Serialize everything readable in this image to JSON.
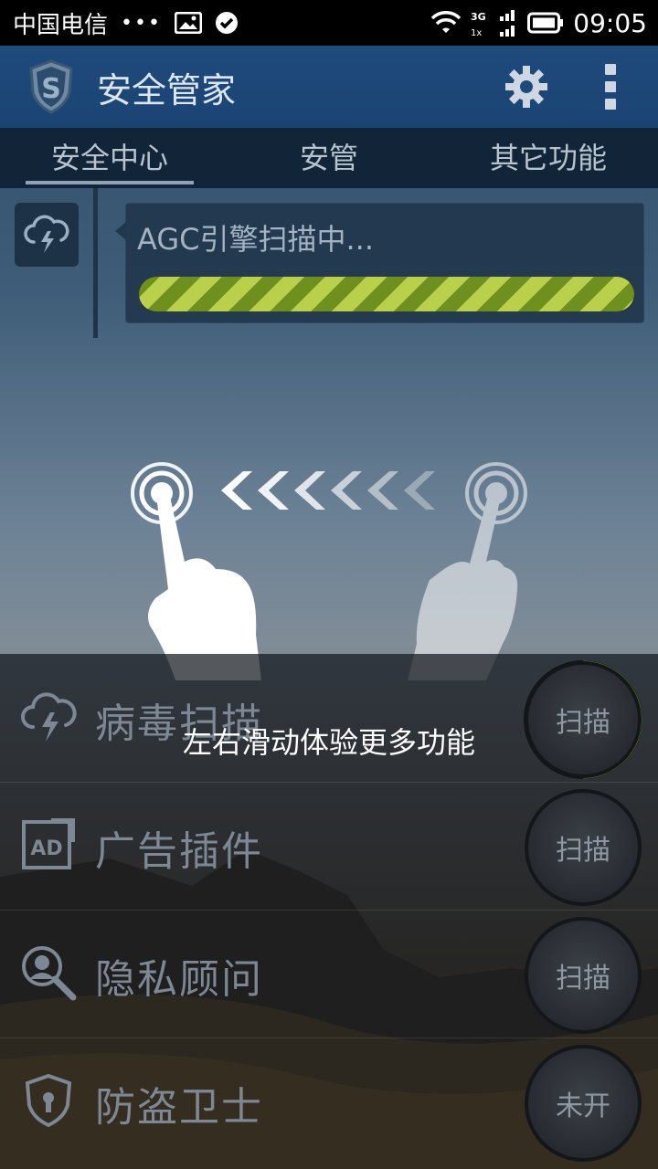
{
  "status_bar": {
    "carrier": "中国电信",
    "dots": "•••",
    "time": "09:05",
    "network": "3G",
    "network_sub": "1x",
    "icons": [
      "image-icon",
      "check-circle-icon",
      "wifi-icon",
      "signal-icon",
      "battery-icon"
    ]
  },
  "app": {
    "title": "安全管家",
    "logo_letter": "S",
    "actions": [
      "gear-icon",
      "more-icon"
    ]
  },
  "tabs": [
    {
      "label": "安全中心",
      "active": true
    },
    {
      "label": "安管",
      "active": false
    },
    {
      "label": "其它功能",
      "active": false
    }
  ],
  "scan": {
    "status_text": "AGC引擎扫描中...",
    "progress_percent": 100,
    "icon": "cloud-lightning-icon"
  },
  "gesture_overlay": {
    "tip": "左右滑动体验更多功能",
    "icons": [
      "tap-hand-icon",
      "swipe-left-chevrons-icon",
      "tap-hand-icon"
    ]
  },
  "list": {
    "items": [
      {
        "label": "病毒扫描",
        "button": "扫描",
        "icon": "cloud-lightning-icon",
        "active_ring": true
      },
      {
        "label": "广告插件",
        "button": "扫描",
        "icon": "ad-icon",
        "active_ring": false
      },
      {
        "label": "隐私顾问",
        "button": "扫描",
        "icon": "privacy-search-icon",
        "active_ring": false
      },
      {
        "label": "防盗卫士",
        "button": "未开",
        "icon": "shield-lock-icon",
        "active_ring": false
      }
    ]
  },
  "colors": {
    "app_bar": "#1f4a7c",
    "tab_bar": "#122437",
    "progress_green": "#8fb12a",
    "active_ring": "#5f8f22"
  }
}
